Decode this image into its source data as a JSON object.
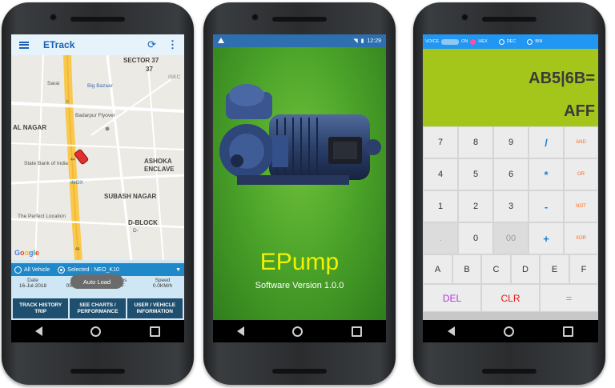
{
  "phone1": {
    "app_title": "ETrack",
    "icons": {
      "menu": "menu-icon",
      "refresh": "refresh-icon",
      "more": "more-vert-icon"
    },
    "map_labels": {
      "sector": "SECTOR 37",
      "sector_num": "37",
      "iskcon": "ISKC",
      "sarai": "Sarai",
      "big_bazaar": "Big Bazaar",
      "al_nagar": "AL NAGAR",
      "badarpur": "Badarpur Flyover",
      "sbi": "State Bank of India",
      "ashoka": "ASHOKA",
      "enclave": "ENCLAVE",
      "inox": "INOX",
      "subash": "SUBASH NAGAR",
      "perfect": "The Perfect Location",
      "dblock": "D-BLOCK",
      "d": "D-",
      "google": "Google",
      "r1": "F",
      "r2": "44",
      "r3": "44"
    },
    "radio_all": "All Vehicle",
    "radio_selected": "Selected : NEO_K10",
    "toast": "Auto Load",
    "info": [
      {
        "header": "Date",
        "value": "16-Jul-2018"
      },
      {
        "header": "Time",
        "value": "05:58:11"
      },
      {
        "header": "Status",
        "value": "OFF"
      },
      {
        "header": "Speed",
        "value": "0.0KM/h"
      }
    ],
    "buttons": [
      "TRACK HISTORY TRIP",
      "SEE CHARTS / PERFORMANCE",
      "USER / VEHICLE INFORMATION"
    ]
  },
  "phone2": {
    "status_time": "12:29",
    "app_name": "EPump",
    "version": "Software Version 1.0.0"
  },
  "phone3": {
    "modes": {
      "voice": "VOICE",
      "on": "ON",
      "hex": "HEX",
      "dec": "DEC",
      "bin": "BIN"
    },
    "expression": "AB5|6B=",
    "result": "AFF",
    "keys": [
      [
        "7",
        "8",
        "9",
        "/",
        "AND"
      ],
      [
        "4",
        "5",
        "6",
        "*",
        "OR"
      ],
      [
        "1",
        "2",
        "3",
        "-",
        "NOT"
      ],
      [
        ".",
        "0",
        "00",
        "+",
        "XOR"
      ],
      [
        "A",
        "B",
        "C",
        "D",
        "E",
        "F"
      ],
      [
        "DEL",
        "CLR",
        "="
      ]
    ]
  }
}
